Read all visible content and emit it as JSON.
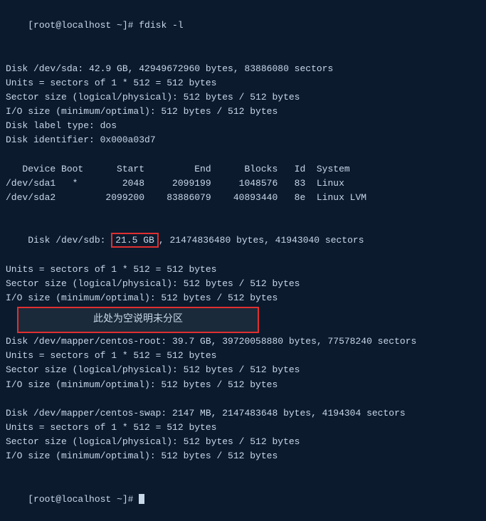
{
  "terminal": {
    "prompt1": "[root@localhost ~]# fdisk -l",
    "blank1": "",
    "disk_sda": {
      "line1": "Disk /dev/sda: 42.9 GB, 42949672960 bytes, 83886080 sectors",
      "line2": "Units = sectors of 1 * 512 = 512 bytes",
      "line3": "Sector size (logical/physical): 512 bytes / 512 bytes",
      "line4": "I/O size (minimum/optimal): 512 bytes / 512 bytes",
      "line5": "Disk label type: dos",
      "line6": "Disk identifier: 0x000a03d7"
    },
    "blank2": "",
    "table_header": "   Device Boot      Start         End      Blocks   Id  System",
    "sda1": "/dev/sda1   *        2048     2099199     1048576   83  Linux",
    "sda2": "/dev/sda2         2099200    83886079    40893440   8e  Linux LVM",
    "blank3": "",
    "disk_sdb": {
      "prefix": "Disk /dev/sdb: ",
      "highlight": "21.5 GB",
      "suffix": ", 21474836480 bytes, 41943040 sectors",
      "line2": "Units = sectors of 1 * 512 = 512 bytes",
      "line3": "Sector size (logical/physical): 512 bytes / 512 bytes",
      "line4": "I/O size (minimum/optimal): 512 bytes / 512 bytes"
    },
    "annotation": "此处为空说明未分区",
    "blank4": "",
    "disk_mapper_root": {
      "line1": "Disk /dev/mapper/centos-root: 39.7 GB, 39720058880 bytes, 77578240 sectors",
      "line2": "Units = sectors of 1 * 512 = 512 bytes",
      "line3": "Sector size (logical/physical): 512 bytes / 512 bytes",
      "line4": "I/O size (minimum/optimal): 512 bytes / 512 bytes"
    },
    "blank5": "",
    "blank6": "",
    "disk_mapper_swap": {
      "line1": "Disk /dev/mapper/centos-swap: 2147 MB, 2147483648 bytes, 4194304 sectors",
      "line2": "Units = sectors of 1 * 512 = 512 bytes",
      "line3": "Sector size (logical/physical): 512 bytes / 512 bytes",
      "line4": "I/O size (minimum/optimal): 512 bytes / 512 bytes"
    },
    "blank7": "",
    "blank8": "",
    "prompt2": "[root@localhost ~]# "
  }
}
